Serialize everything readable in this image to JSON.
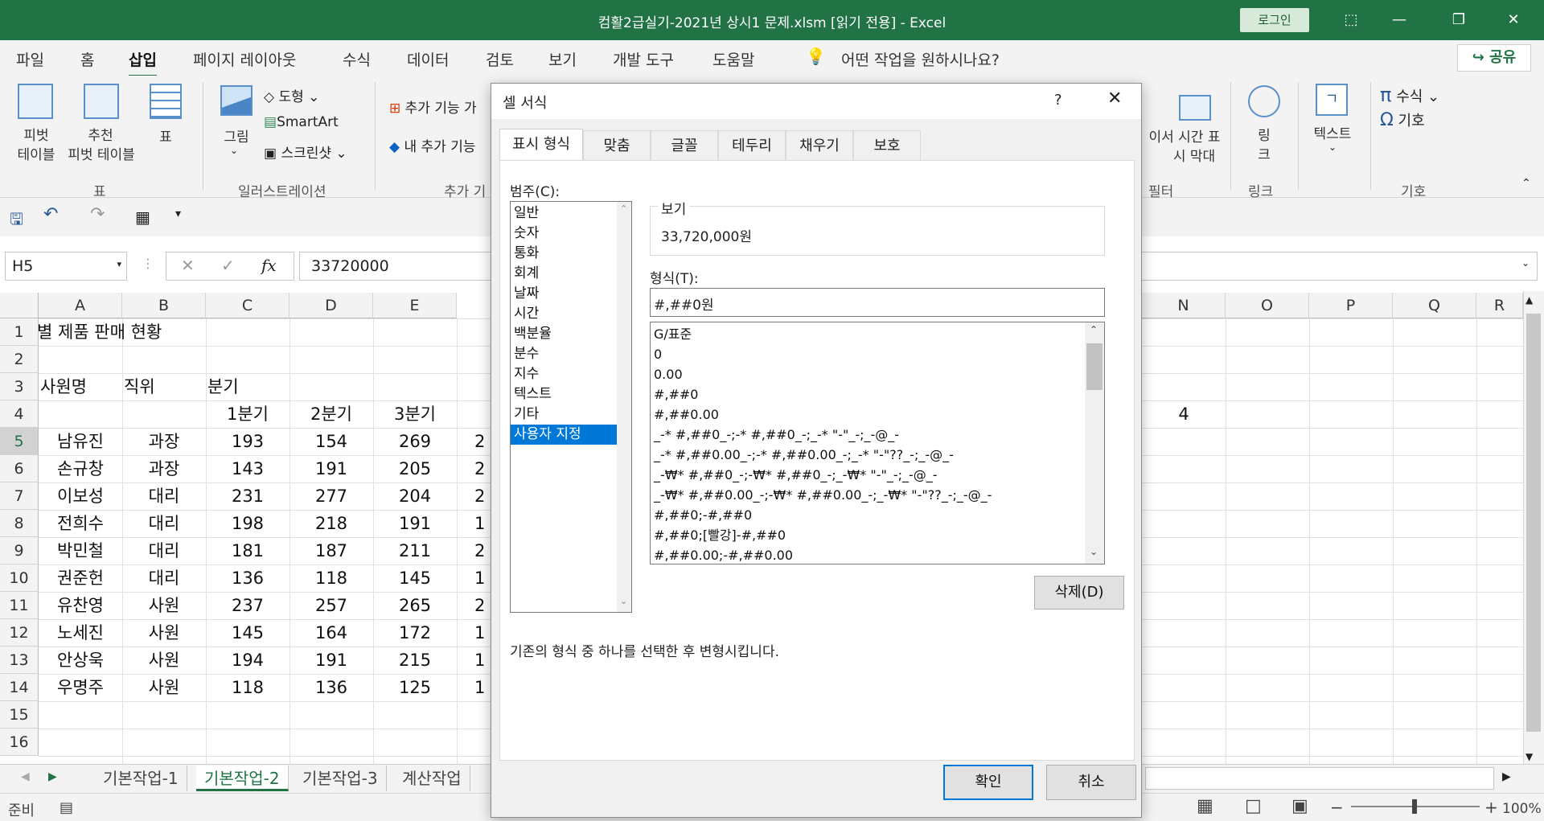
{
  "window": {
    "title": "컴활2급실기-2021년 상시1 문제.xlsm  [읽기 전용]  -  Excel",
    "login": "로그인"
  },
  "menu": {
    "items": [
      "파일",
      "홈",
      "삽입",
      "페이지 레이아웃",
      "수식",
      "데이터",
      "검토",
      "보기",
      "개발 도구",
      "도움말"
    ],
    "tell_me": "어떤 작업을 원하시나요?",
    "share": "공유"
  },
  "ribbon": {
    "pivot_line1": "피벗",
    "pivot_line2": "테이블",
    "rec_pivot_line1": "추천",
    "rec_pivot_line2": "피벗 테이블",
    "table": "표",
    "group_table": "표",
    "pictures": "그림",
    "shapes": "도형",
    "smartart": "SmartArt",
    "screenshot": "스크린샷",
    "group_illustrations": "일러스트레이션",
    "addins_get": "추가 기능 가",
    "addins_my": "내 추가 기능",
    "group_addins": "추가 기",
    "slicer_partial": "이서 시간 표",
    "timeline_partial": "시 막대",
    "group_filter": "필터",
    "link_line1": "링",
    "link_line2": "크",
    "group_link": "링크",
    "text": "텍스트",
    "equation": "수식",
    "symbol": "기호",
    "group_symbols": "기호"
  },
  "formula_bar": {
    "name_box": "H5",
    "fx": "fx",
    "value": "33720000"
  },
  "sheet": {
    "columns": [
      "A",
      "B",
      "C",
      "D",
      "E",
      "N",
      "O",
      "P",
      "Q",
      "R"
    ],
    "rows": [
      "1",
      "2",
      "3",
      "4",
      "5",
      "6",
      "7",
      "8",
      "9",
      "10",
      "11",
      "12",
      "13",
      "14",
      "15",
      "16"
    ],
    "title": "별 제품 판매 현황",
    "header_name": "사원명",
    "header_title": "직위",
    "header_quarter": "분기",
    "quarters": [
      "1분기",
      "2분기",
      "3분기",
      "4"
    ],
    "data": [
      {
        "name": "남유진",
        "title": "과장",
        "q1": "193",
        "q2": "154",
        "q3": "269",
        "q4": "2"
      },
      {
        "name": "손규창",
        "title": "과장",
        "q1": "143",
        "q2": "191",
        "q3": "205",
        "q4": "2"
      },
      {
        "name": "이보성",
        "title": "대리",
        "q1": "231",
        "q2": "277",
        "q3": "204",
        "q4": "2"
      },
      {
        "name": "전희수",
        "title": "대리",
        "q1": "198",
        "q2": "218",
        "q3": "191",
        "q4": "1"
      },
      {
        "name": "박민철",
        "title": "대리",
        "q1": "181",
        "q2": "187",
        "q3": "211",
        "q4": "2"
      },
      {
        "name": "권준헌",
        "title": "대리",
        "q1": "136",
        "q2": "118",
        "q3": "145",
        "q4": "1"
      },
      {
        "name": "유찬영",
        "title": "사원",
        "q1": "237",
        "q2": "257",
        "q3": "265",
        "q4": "2"
      },
      {
        "name": "노세진",
        "title": "사원",
        "q1": "145",
        "q2": "164",
        "q3": "172",
        "q4": "1"
      },
      {
        "name": "안상욱",
        "title": "사원",
        "q1": "194",
        "q2": "191",
        "q3": "215",
        "q4": "1"
      },
      {
        "name": "우명주",
        "title": "사원",
        "q1": "118",
        "q2": "136",
        "q3": "125",
        "q4": "1"
      }
    ]
  },
  "sheet_tabs": [
    "기본작업-1",
    "기본작업-2",
    "기본작업-3",
    "계산작업"
  ],
  "status": {
    "ready": "준비",
    "zoom": "100%"
  },
  "dialog": {
    "title": "셀 서식",
    "help": "?",
    "tabs": [
      "표시 형식",
      "맞춤",
      "글꼴",
      "테두리",
      "채우기",
      "보호"
    ],
    "category_label": "범주(C):",
    "categories": [
      "일반",
      "숫자",
      "통화",
      "회계",
      "날짜",
      "시간",
      "백분율",
      "분수",
      "지수",
      "텍스트",
      "기타",
      "사용자 지정"
    ],
    "preview_label": "보기",
    "preview_value": "33,720,000원",
    "format_label": "형식(T):",
    "format_value": "#,##0원",
    "formats": [
      "G/표준",
      "0",
      "0.00",
      "#,##0",
      "#,##0.00",
      "_-* #,##0_-;-* #,##0_-;_-* \"-\"_-;_-@_-",
      "_-* #,##0.00_-;-* #,##0.00_-;_-* \"-\"??_-;_-@_-",
      "_-₩* #,##0_-;-₩* #,##0_-;_-₩* \"-\"_-;_-@_-",
      "_-₩* #,##0.00_-;-₩* #,##0.00_-;_-₩* \"-\"??_-;_-@_-",
      "#,##0;-#,##0",
      "#,##0;[빨강]-#,##0",
      "#,##0.00;-#,##0.00"
    ],
    "delete_button": "삭제(D)",
    "description": "기존의 형식 중 하나를 선택한 후 변형시킵니다.",
    "ok": "확인",
    "cancel": "취소"
  }
}
